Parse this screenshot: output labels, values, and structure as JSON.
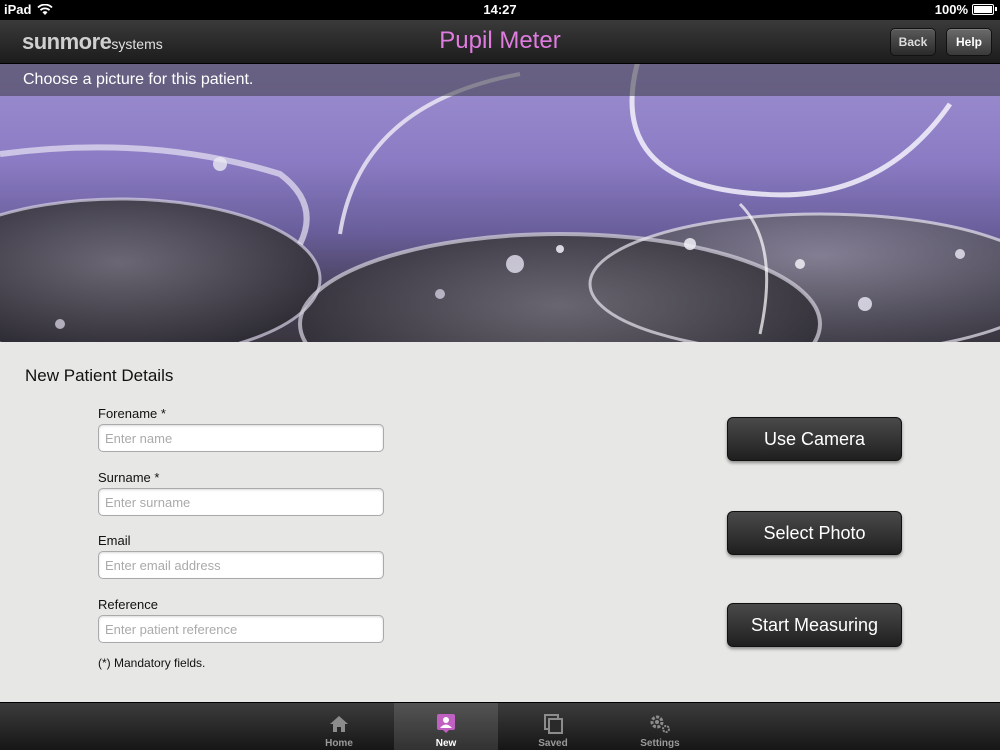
{
  "status_bar": {
    "device": "iPad",
    "time": "14:27",
    "battery": "100%"
  },
  "nav": {
    "brand": "sunmore",
    "brand_suffix": "systems",
    "title": "Pupil Meter",
    "back_label": "Back",
    "help_label": "Help",
    "title_color": "#e07be0"
  },
  "hero": {
    "instruction": "Choose a picture for this patient."
  },
  "form": {
    "title": "New Patient Details",
    "fields": [
      {
        "label": "Forename *",
        "placeholder": "Enter name",
        "value": ""
      },
      {
        "label": "Surname *",
        "placeholder": "Enter surname",
        "value": ""
      },
      {
        "label": "Email",
        "placeholder": "Enter email address",
        "value": ""
      },
      {
        "label": "Reference",
        "placeholder": "Enter patient reference",
        "value": ""
      }
    ],
    "mandatory_note": "(*) Mandatory fields."
  },
  "actions": {
    "use_camera": "Use Camera",
    "select_photo": "Select Photo",
    "start_measuring": "Start Measuring"
  },
  "tabbar": {
    "tabs": [
      {
        "label": "Home",
        "icon": "home-icon",
        "active": false
      },
      {
        "label": "New",
        "icon": "new-patient-icon",
        "active": true
      },
      {
        "label": "Saved",
        "icon": "saved-icon",
        "active": false
      },
      {
        "label": "Settings",
        "icon": "gear-icon",
        "active": false
      }
    ],
    "active_color": "#c060c0"
  }
}
